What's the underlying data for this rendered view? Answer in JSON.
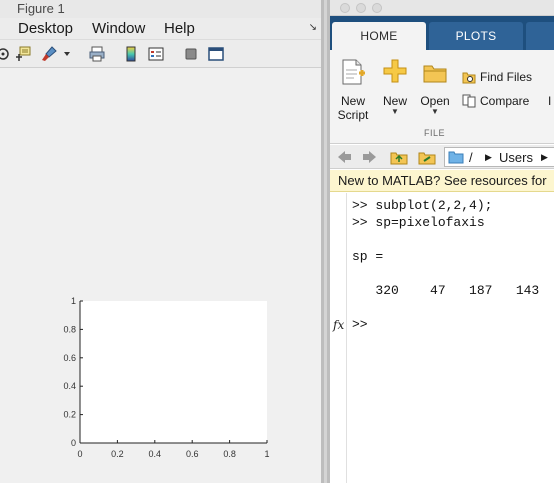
{
  "figure": {
    "title": "Figure 1",
    "menu": [
      "Desktop",
      "Window",
      "Help"
    ],
    "toolbar_icons": [
      "rotate-icon",
      "data-cursor-icon",
      "brush-icon",
      "brush-dropdown-icon",
      "print-icon",
      "colorbar-icon",
      "legend-icon",
      "hide-tools-icon",
      "dock-icon"
    ]
  },
  "chart_data": {
    "type": "line",
    "title": "",
    "xlabel": "",
    "ylabel": "",
    "xlim": [
      0,
      1
    ],
    "ylim": [
      0,
      1
    ],
    "x_ticks": [
      "0",
      "0.2",
      "0.4",
      "0.6",
      "0.8",
      "1"
    ],
    "y_ticks": [
      "0",
      "0.2",
      "0.4",
      "0.6",
      "0.8",
      "1"
    ],
    "series": [],
    "grid": false
  },
  "matlab": {
    "tabs": [
      "HOME",
      "PLOTS"
    ],
    "buttons": {
      "new_script": [
        "New",
        "Script"
      ],
      "new": "New",
      "open": "Open",
      "find_files": "Find Files",
      "compare": "Compare",
      "cut_off": "I"
    },
    "section_label": "FILE",
    "path": [
      "/",
      "Users"
    ],
    "banner": "New to MATLAB? See resources for",
    "command_lines": [
      ">> subplot(2,2,4);",
      ">> sp=pixelofaxis",
      "sp =",
      "   320    47   187   143",
      ">> "
    ],
    "fx_label": "fx"
  },
  "colors": {
    "ribbon_dark": "#1e4f7e",
    "tab_active": "#f3f3f3",
    "banner": "#fdf6cf",
    "figure_bg": "#f0f0f0",
    "axes_bg": "#ffffff"
  }
}
